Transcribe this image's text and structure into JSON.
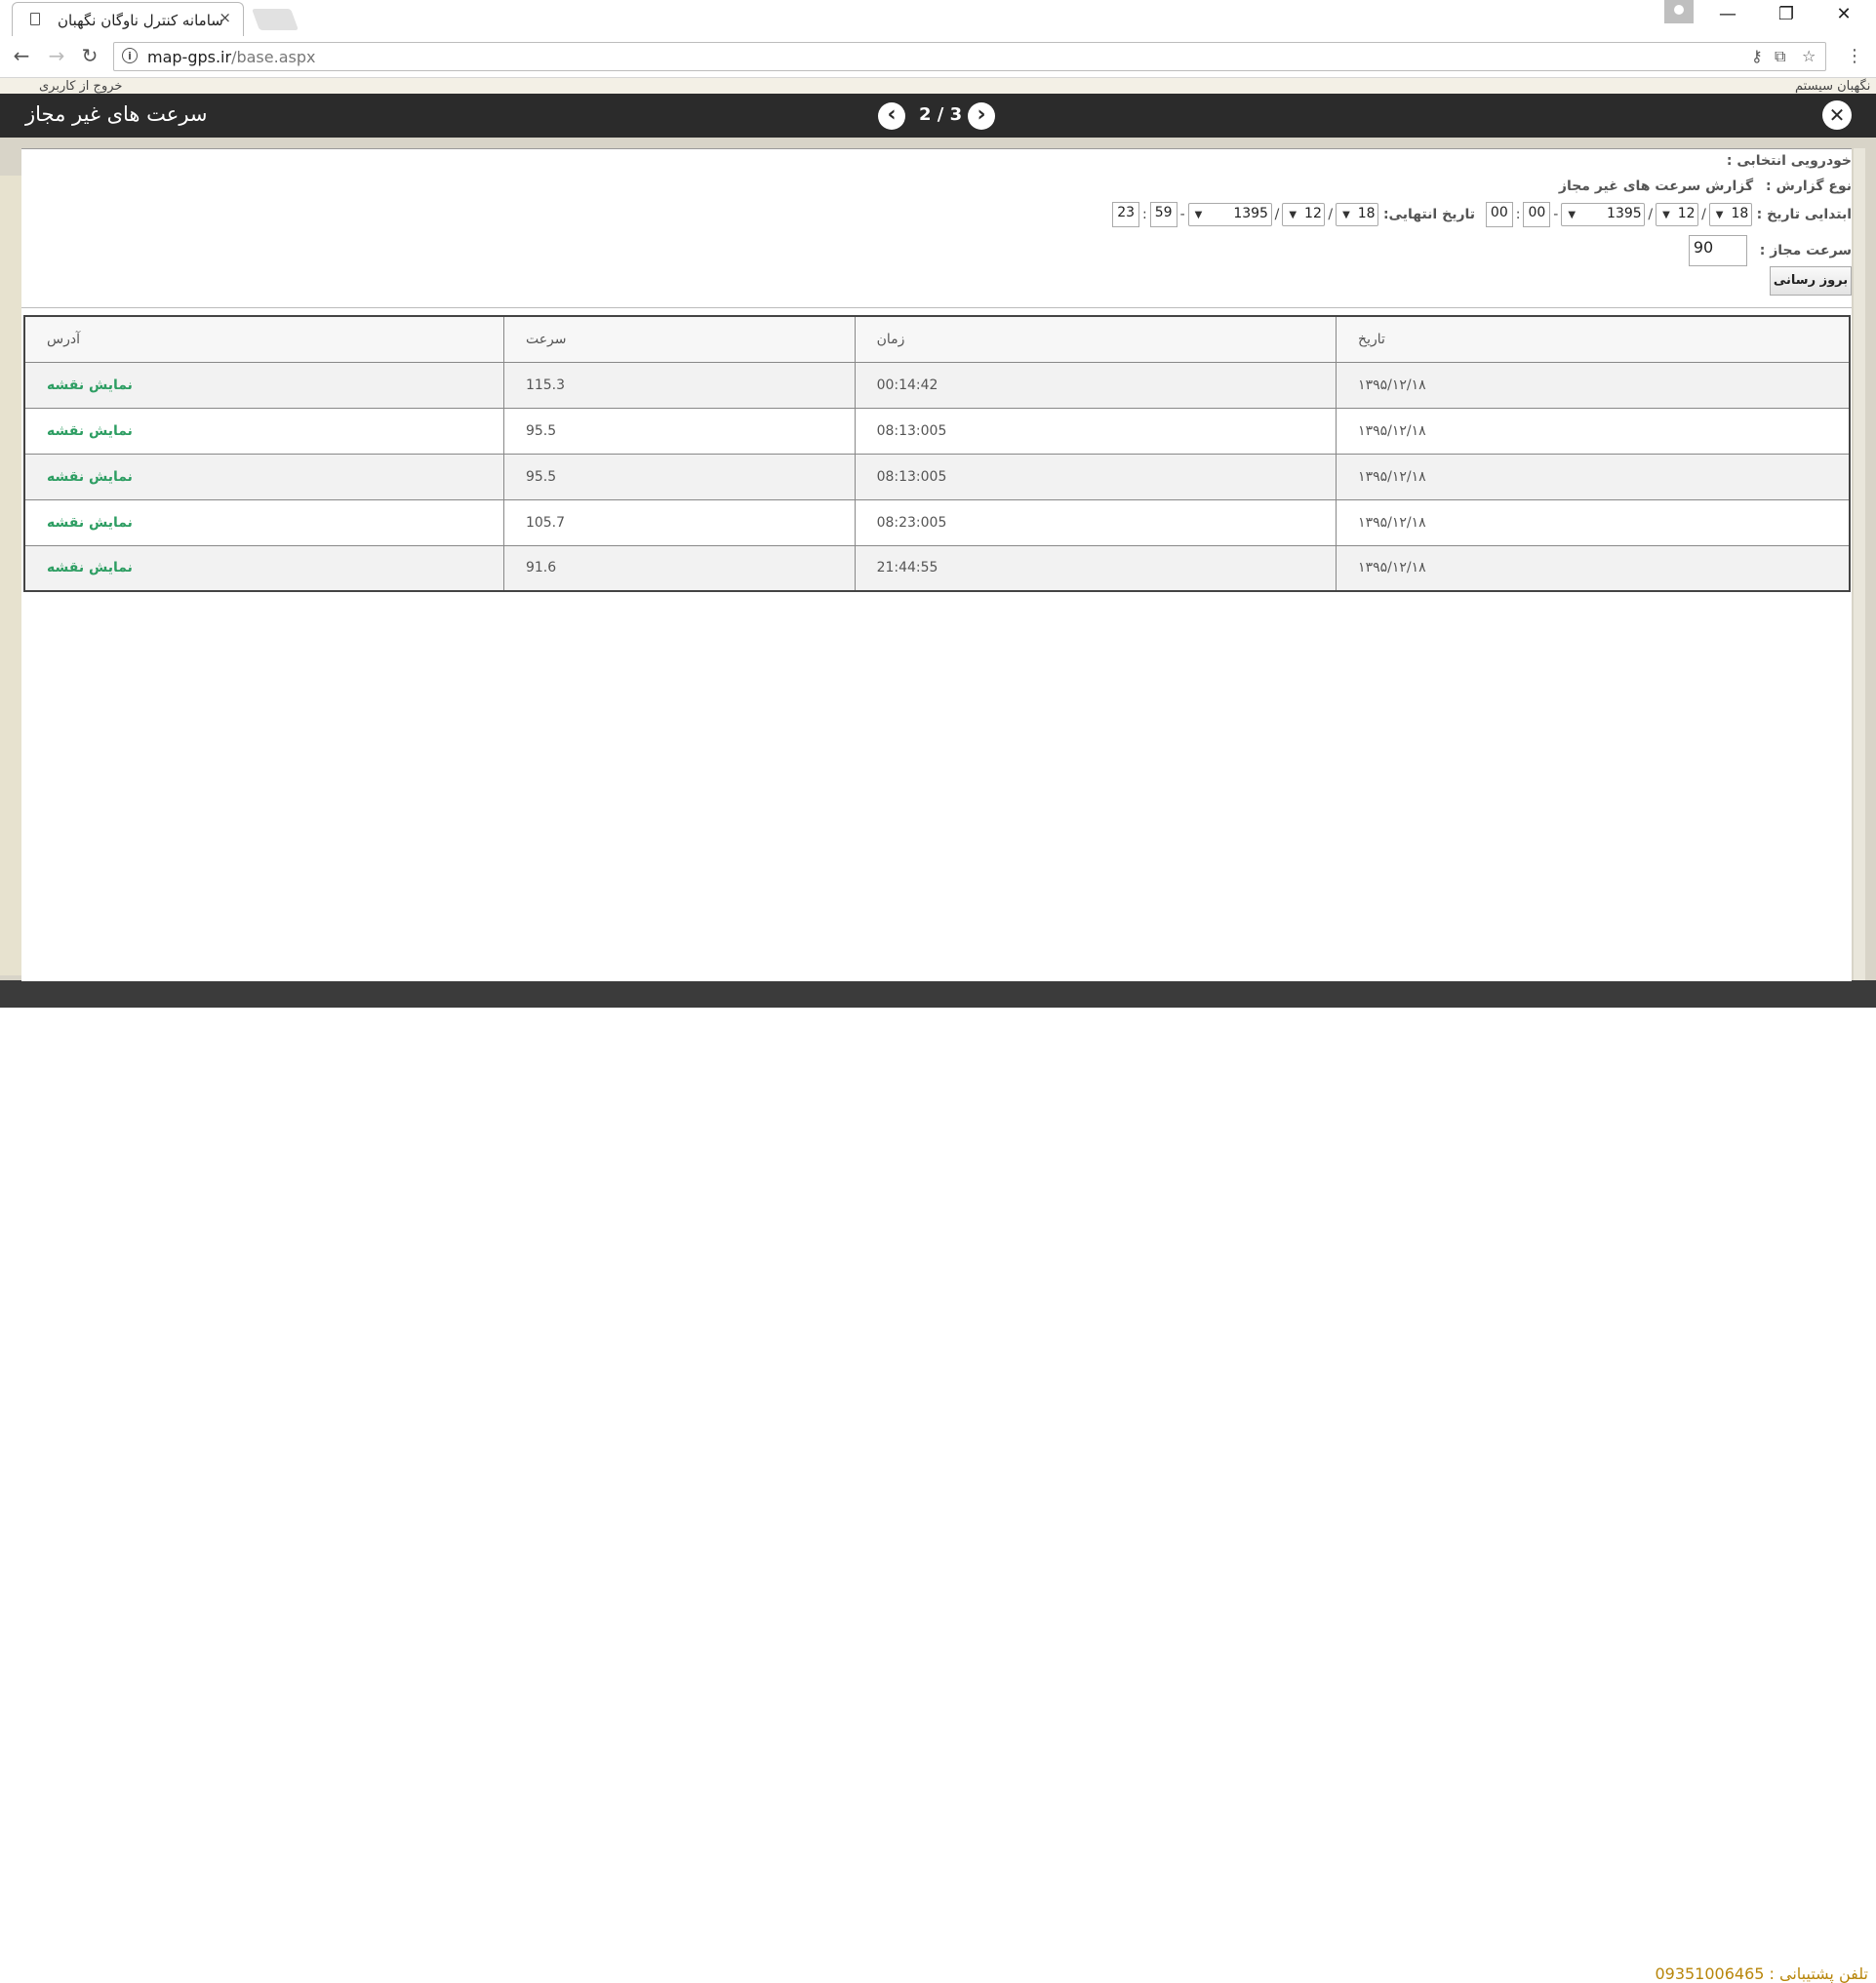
{
  "browser": {
    "tab_title": "سامانه کنترل ناوگان نگهبان",
    "tab_close": "×",
    "url_host": "map-gps.ir",
    "url_path": "/base.aspx",
    "window_controls": [
      "—",
      "❐",
      "✕"
    ]
  },
  "background": {
    "top_left_text": "خروج از کاربری",
    "top_right_text": "نگهبان سیستم",
    "support_label": "تلفن پشتیبانی :",
    "support_phone": "09351006465"
  },
  "modal": {
    "title": "سرعت های غیر مجاز",
    "pager": "2 / 3",
    "prev_icon": "chevron-left-icon",
    "next_icon": "chevron-right-icon",
    "close_icon": "close-icon"
  },
  "params": {
    "vehicle_label": "خودرویی انتخابی :",
    "report_type_label": "نوع گزارش :",
    "report_type_value": "گزارش سرعت های غیر مجاز",
    "start_date_label": "ابتدایی تاریخ :",
    "end_date_label": "تاریخ انتهایی:",
    "start": {
      "day": "18",
      "month": "12",
      "year": "1395",
      "hour": "00",
      "minute": "00"
    },
    "end": {
      "day": "18",
      "month": "12",
      "year": "1395",
      "hour": "23",
      "minute": "59"
    },
    "speed_label": "سرعت مجاز :",
    "speed_value": "90",
    "refresh_button": "بروز رسانی"
  },
  "table": {
    "headers": [
      "آدرس",
      "سرعت",
      "زمان",
      "تاریخ"
    ],
    "rows": [
      {
        "address": "نمایش نقشه",
        "speed": "115.3",
        "time": "00:14:42",
        "date": "۱۳۹۵/۱۲/۱۸"
      },
      {
        "address": "نمایش نقشه",
        "speed": "95.5",
        "time": "08:13:005",
        "date": "۱۳۹۵/۱۲/۱۸"
      },
      {
        "address": "نمایش نقشه",
        "speed": "95.5",
        "time": "08:13:005",
        "date": "۱۳۹۵/۱۲/۱۸"
      },
      {
        "address": "نمایش نقشه",
        "speed": "105.7",
        "time": "08:23:005",
        "date": "۱۳۹۵/۱۲/۱۸"
      },
      {
        "address": "نمایش نقشه",
        "speed": "91.6",
        "time": "21:44:55",
        "date": "۱۳۹۵/۱۲/۱۸"
      }
    ]
  },
  "colors": {
    "modal_header": "#2b2b2b",
    "link": "#2e9e63",
    "support": "#b8860b"
  }
}
